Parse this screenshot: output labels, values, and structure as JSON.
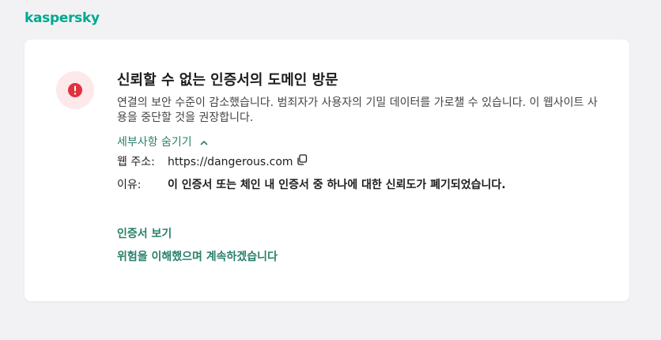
{
  "brand": {
    "logo_text": "kaspersky",
    "color": "#00a88e"
  },
  "alert": {
    "icon": "exclamation-icon",
    "icon_color": "#e0313f",
    "title": "신뢰할 수 없는 인증서의 도메인 방문",
    "description": "연결의 보안 수준이 감소했습니다. 범죄자가 사용자의 기밀 데이터를 가로챌 수 있습니다. 이 웹사이트 사용을 중단할 것을 권장합니다.",
    "details_toggle": "세부사항 숨기기"
  },
  "details": {
    "url_label": "웹 주소:",
    "url_value": "https://dangerous.com",
    "reason_label": "이유:",
    "reason_value": "이 인증서 또는 체인 내 인증서 중 하나에 대한 신뢰도가 폐기되었습니다."
  },
  "actions": {
    "view_certificate": "인증서 보기",
    "accept_risk": "위험을 이해했으며 계속하겠습니다"
  },
  "colors": {
    "link": "#29806a",
    "background": "#f2f2f5",
    "card": "#ffffff"
  }
}
